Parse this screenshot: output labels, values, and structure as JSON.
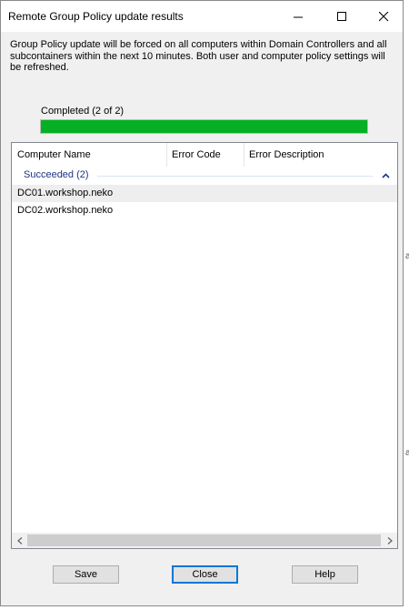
{
  "window": {
    "title": "Remote Group Policy update results",
    "minimize_icon": "minimize-icon",
    "maximize_icon": "maximize-icon",
    "close_icon": "close-icon"
  },
  "description": "Group Policy update will be forced on all computers within Domain Controllers and all subcontainers within the next 10 minutes. Both user and computer policy settings will be refreshed.",
  "progress": {
    "label": "Completed (2 of 2)",
    "completed": 2,
    "total": 2,
    "fraction": 1.0,
    "color": "#06b025"
  },
  "list": {
    "columns": [
      "Computer Name",
      "Error Code",
      "Error Description"
    ],
    "group": {
      "label": "Succeeded (2)",
      "toggle_icon": "chevron-up-icon"
    },
    "rows": [
      "DC01.workshop.neko",
      "DC02.workshop.neko"
    ],
    "scroll_left_icon": "chevron-left-icon",
    "scroll_right_icon": "chevron-right-icon"
  },
  "buttons": {
    "save": "Save",
    "close": "Close",
    "help": "Help"
  },
  "background_edge": {
    "glyph_1": "a",
    "glyph_2": "a"
  }
}
